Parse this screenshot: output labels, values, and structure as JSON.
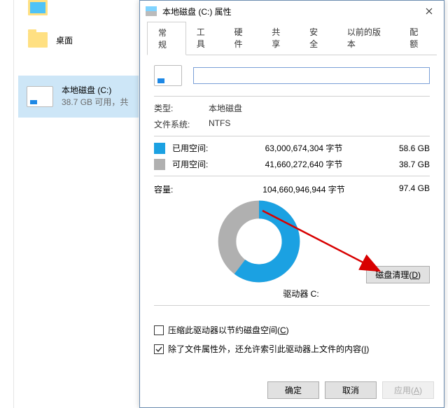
{
  "explorer": {
    "desktop_label": "桌面",
    "drive": {
      "name": "本地磁盘 (C:)",
      "subtitle": "38.7 GB 可用，共 "
    }
  },
  "dialog": {
    "title": "本地磁盘 (C:) 属性",
    "tabs": [
      "常规",
      "工具",
      "硬件",
      "共享",
      "安全",
      "以前的版本",
      "配额"
    ],
    "name_input_value": "",
    "type_label": "类型:",
    "type_value": "本地磁盘",
    "fs_label": "文件系统:",
    "fs_value": "NTFS",
    "used_label": "已用空间:",
    "used_bytes": "63,000,674,304 字节",
    "used_gb": "58.6 GB",
    "free_label": "可用空间:",
    "free_bytes": "41,660,272,640 字节",
    "free_gb": "38.7 GB",
    "capacity_label": "容量:",
    "capacity_bytes": "104,660,946,944 字节",
    "capacity_gb": "97.4 GB",
    "drive_caption": "驱动器 C:",
    "cleanup_button": "磁盘清理(D)",
    "compress_label": "压缩此驱动器以节约磁盘空间(C)",
    "index_label": "除了文件属性外，还允许索引此驱动器上文件的内容(I)",
    "ok": "确定",
    "cancel": "取消",
    "apply": "应用(A)"
  },
  "chart_data": {
    "type": "pie",
    "title": "驱动器 C:",
    "series": [
      {
        "name": "已用空间",
        "value": 58.6,
        "color": "#1ba1e2"
      },
      {
        "name": "可用空间",
        "value": 38.7,
        "color": "#b0b0b0"
      }
    ],
    "unit": "GB",
    "total": 97.4
  }
}
